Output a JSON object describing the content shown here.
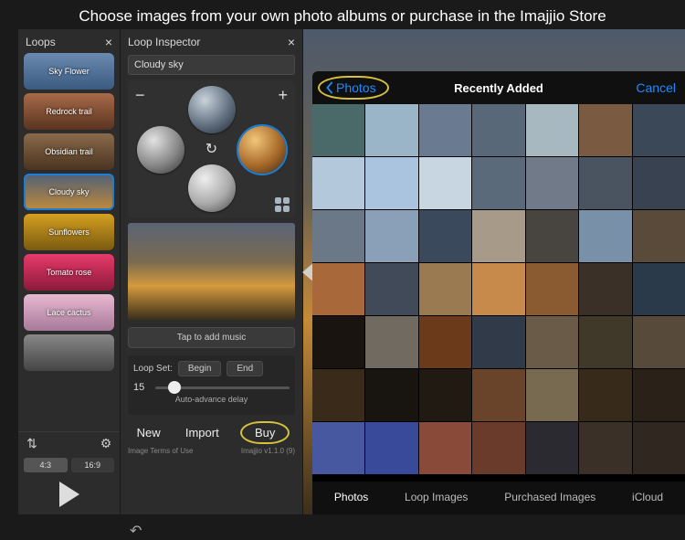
{
  "headline": "Choose images from your own photo albums or purchase in the Imajjio Store",
  "loops": {
    "title": "Loops",
    "items": [
      {
        "label": "Sky Flower",
        "bg": "linear-gradient(#6a8ab0,#3a5a80)"
      },
      {
        "label": "Redrock trail",
        "bg": "linear-gradient(#a86a4a,#5a3420)"
      },
      {
        "label": "Obsidian trail",
        "bg": "linear-gradient(#8a6a4a,#4a3420)"
      },
      {
        "label": "Cloudy sky",
        "bg": "linear-gradient(#506078,#c08a3a)",
        "selected": true
      },
      {
        "label": "Sunflowers",
        "bg": "linear-gradient(#d4a020,#7a5a10)"
      },
      {
        "label": "Tomato rose",
        "bg": "linear-gradient(#e83a6a,#8a1a3a)"
      },
      {
        "label": "Lace cactus",
        "bg": "linear-gradient(#e8b8d0,#a87a9a)"
      },
      {
        "label": "",
        "bg": "linear-gradient(#888,#444)"
      }
    ],
    "ratios": {
      "a": "4:3",
      "b": "16:9"
    }
  },
  "inspector": {
    "title": "Loop Inspector",
    "name": "Cloudy sky",
    "music_btn": "Tap to add music",
    "loopset": {
      "label": "Loop Set:",
      "begin": "Begin",
      "end": "End",
      "delay_value": "15",
      "delay_caption": "Auto-advance delay"
    },
    "actions": {
      "new": "New",
      "import": "Import",
      "buy": "Buy"
    },
    "footer": {
      "terms": "Image Terms of Use",
      "version": "Imajjio v1.1.0 (9)"
    }
  },
  "picker": {
    "back": "Photos",
    "title": "Recently Added",
    "cancel": "Cancel",
    "tabs": [
      "Photos",
      "Loop Images",
      "Purchased Images",
      "iCloud"
    ],
    "active_tab": 0,
    "grid_rows": 7,
    "grid_cols": 7,
    "cell_colors": [
      "#4a6a6a",
      "#9ab4c8",
      "#6a7a90",
      "#586878",
      "#a8b8c0",
      "#7a5a40",
      "#3a4858",
      "#b4c8dc",
      "#aac4e0",
      "#c8d6e2",
      "#5a6a7a",
      "#707a88",
      "#4a5460",
      "#384250",
      "#6a7888",
      "#8aa0b8",
      "#3a4a5c",
      "#a89a88",
      "#484440",
      "#7890a8",
      "#5a4a3a",
      "#a8683a",
      "#404a58",
      "#9a7a50",
      "#c88a4a",
      "#8a5a30",
      "#3a3028",
      "#2a3a4a",
      "#1a1410",
      "#706a60",
      "#6a3a1a",
      "#303a48",
      "#6a5a48",
      "#403828",
      "#584a3a",
      "#3a2a1a",
      "#181410",
      "#201a12",
      "#6a442a",
      "#786a50",
      "#382a1a",
      "#2a2218",
      "#4858a0",
      "#3a4a9a",
      "#8a4a3a",
      "#6a3a2a",
      "#2a2a30",
      "#3a3028",
      "#302820"
    ]
  }
}
